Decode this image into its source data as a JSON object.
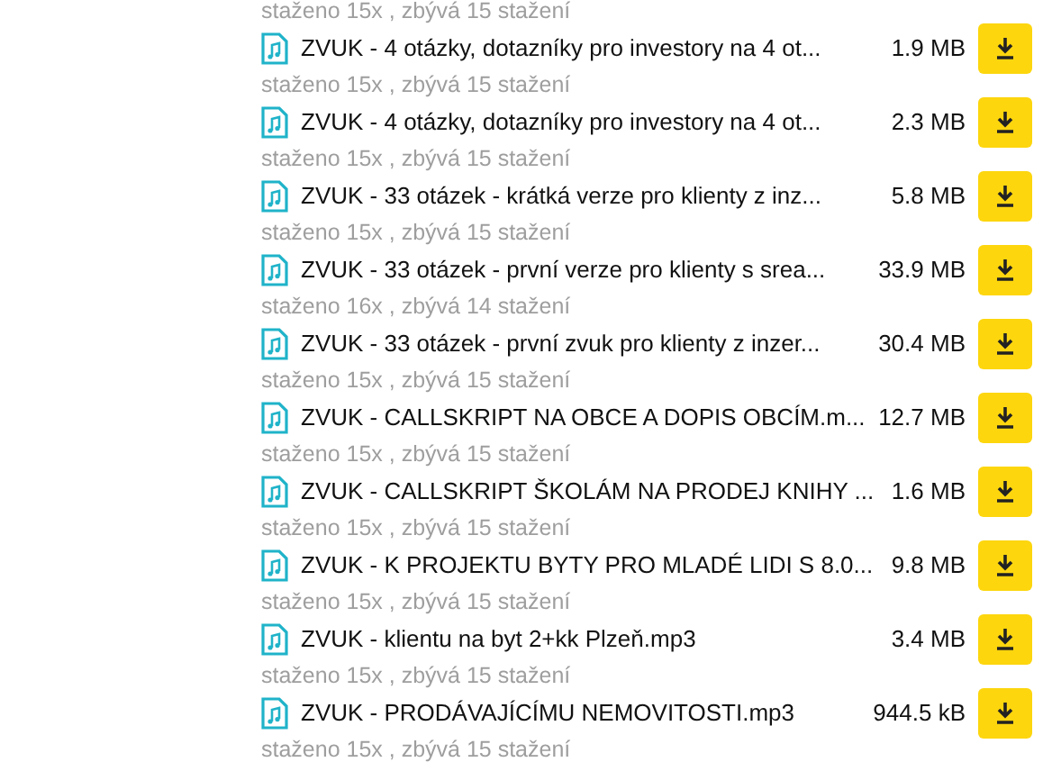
{
  "top_status": "staženo 15x , zbývá 15 stažení",
  "files": [
    {
      "name": "ZVUK - 4 otázky, dotazníky pro investory na 4 ot...",
      "size": "1.9 MB",
      "status": "staženo 15x , zbývá 15 stažení"
    },
    {
      "name": "ZVUK - 4 otázky, dotazníky pro investory na 4 ot...",
      "size": "2.3 MB",
      "status": "staženo 15x , zbývá 15 stažení"
    },
    {
      "name": "ZVUK - 33 otázek - krátká verze pro klienty z inz...",
      "size": "5.8 MB",
      "status": "staženo 15x , zbývá 15 stažení"
    },
    {
      "name": "ZVUK - 33 otázek - první verze pro klienty s srea...",
      "size": "33.9 MB",
      "status": "staženo 16x , zbývá 14 stažení"
    },
    {
      "name": "ZVUK - 33 otázek - první zvuk pro klienty z inzer...",
      "size": "30.4 MB",
      "status": "staženo 15x , zbývá 15 stažení"
    },
    {
      "name": "ZVUK - CALLSKRIPT NA OBCE A DOPIS OBCÍM.m...",
      "size": "12.7 MB",
      "status": "staženo 15x , zbývá 15 stažení"
    },
    {
      "name": "ZVUK - CALLSKRIPT ŠKOLÁM NA PRODEJ KNIHY ...",
      "size": "1.6 MB",
      "status": "staženo 15x , zbývá 15 stažení"
    },
    {
      "name": "ZVUK - K PROJEKTU BYTY PRO MLADÉ LIDI S 8.0...",
      "size": "9.8 MB",
      "status": "staženo 15x , zbývá 15 stažení"
    },
    {
      "name": "ZVUK - klientu na byt 2+kk Plzeň.mp3",
      "size": "3.4 MB",
      "status": "staženo 15x , zbývá 15 stažení"
    },
    {
      "name": "ZVUK - PRODÁVAJÍCÍMU NEMOVITOSTI.mp3",
      "size": "944.5 kB",
      "status": "staženo 15x , zbývá 15 stažení"
    }
  ]
}
